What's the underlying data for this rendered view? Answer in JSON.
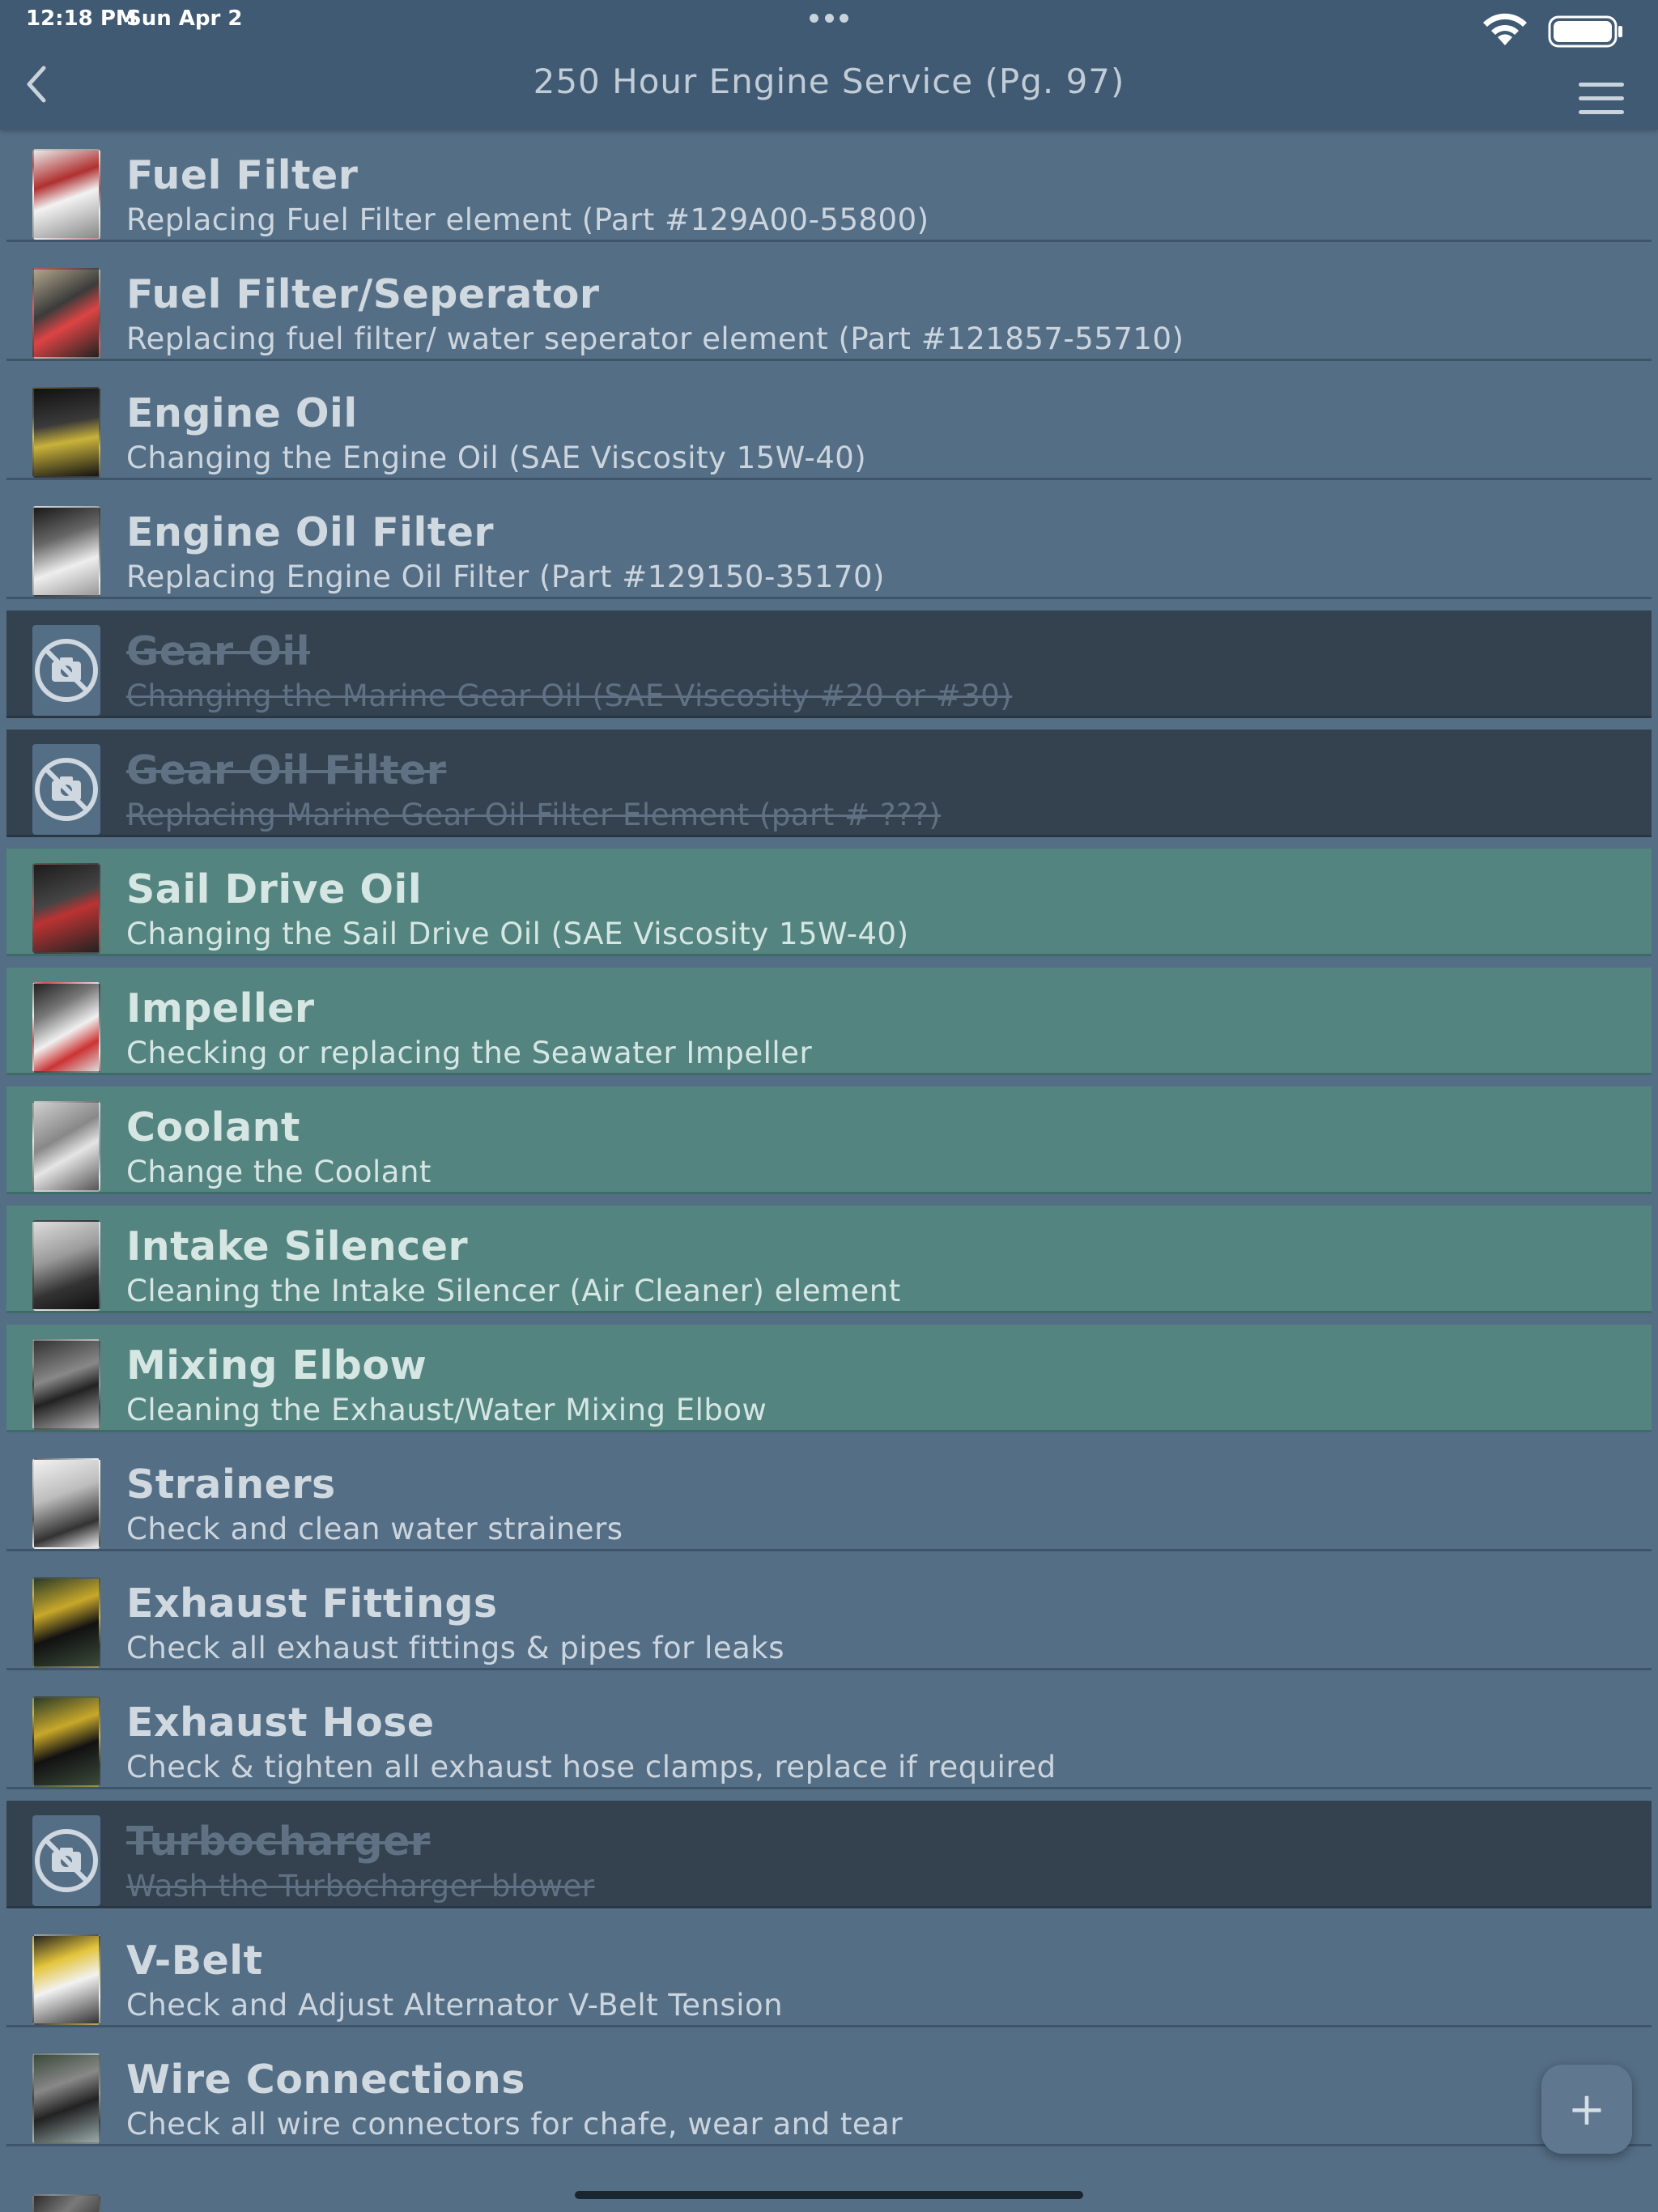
{
  "status": {
    "time": "12:18 PM",
    "date": "Sun Apr 2"
  },
  "nav": {
    "title": "250 Hour Engine Service (Pg. 97)",
    "back_icon": "chevron-left-icon",
    "menu_icon": "hamburger-menu-icon"
  },
  "colors": {
    "normal": "#546e85",
    "done": "#548480",
    "disabled": "#344250",
    "header": "#3f5a72"
  },
  "items": [
    {
      "title": "Fuel Filter",
      "subtitle": "Replacing Fuel Filter element (Part #129A00-55800)",
      "state": "normal",
      "thumb": "photo"
    },
    {
      "title": "Fuel Filter/Seperator",
      "subtitle": "Replacing fuel filter/ water seperator element (Part #121857-55710)",
      "state": "normal",
      "thumb": "photo"
    },
    {
      "title": "Engine Oil",
      "subtitle": "Changing the Engine Oil (SAE Viscosity 15W-40)",
      "state": "normal",
      "thumb": "photo"
    },
    {
      "title": "Engine Oil Filter",
      "subtitle": "Replacing Engine Oil Filter (Part #129150-35170)",
      "state": "normal",
      "thumb": "photo"
    },
    {
      "title": "Gear Oil",
      "subtitle": "Changing the Marine Gear Oil (SAE Viscosity #20 or #30)",
      "state": "disabled",
      "thumb": "no-photo"
    },
    {
      "title": "Gear Oil Filter",
      "subtitle": "Replacing Marine Gear Oil Filter Element (part # ???)",
      "state": "disabled",
      "thumb": "no-photo"
    },
    {
      "title": "Sail Drive Oil",
      "subtitle": "Changing the Sail Drive Oil (SAE Viscosity 15W-40)",
      "state": "done",
      "thumb": "photo"
    },
    {
      "title": "Impeller",
      "subtitle": "Checking or replacing the Seawater Impeller",
      "state": "done",
      "thumb": "photo"
    },
    {
      "title": "Coolant",
      "subtitle": "Change the Coolant",
      "state": "done",
      "thumb": "photo"
    },
    {
      "title": "Intake Silencer",
      "subtitle": "Cleaning the Intake Silencer (Air Cleaner) element",
      "state": "done",
      "thumb": "photo"
    },
    {
      "title": "Mixing Elbow",
      "subtitle": "Cleaning the Exhaust/Water Mixing Elbow",
      "state": "done",
      "thumb": "photo"
    },
    {
      "title": "Strainers",
      "subtitle": "Check and clean water strainers",
      "state": "normal",
      "thumb": "photo"
    },
    {
      "title": "Exhaust Fittings",
      "subtitle": "Check all exhaust fittings & pipes for leaks",
      "state": "normal",
      "thumb": "photo"
    },
    {
      "title": "Exhaust Hose",
      "subtitle": "Check & tighten all exhaust hose clamps, replace if required",
      "state": "normal",
      "thumb": "photo"
    },
    {
      "title": "Turbocharger",
      "subtitle": "Wash the Turbocharger blower",
      "state": "disabled",
      "thumb": "no-photo"
    },
    {
      "title": "V-Belt",
      "subtitle": "Check and Adjust Alternator V-Belt Tension",
      "state": "normal",
      "thumb": "photo"
    },
    {
      "title": "Wire Connections",
      "subtitle": "Check all wire connectors for chafe, wear and tear",
      "state": "normal",
      "thumb": "photo"
    }
  ],
  "fab": {
    "label": "+"
  }
}
